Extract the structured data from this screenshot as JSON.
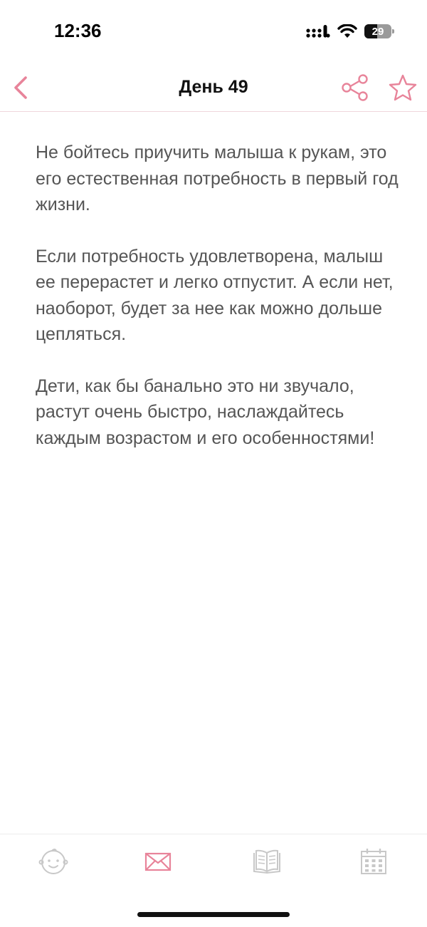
{
  "status_bar": {
    "time": "12:36",
    "battery_level": "29",
    "icons": [
      "cellular-signal-icon",
      "wifi-icon",
      "battery-icon"
    ]
  },
  "nav": {
    "title": "День 49",
    "icons": [
      "chevron-left-icon",
      "share-icon",
      "star-icon"
    ]
  },
  "content": {
    "paragraphs": [
      "Не бойтесь приучить малыша к рукам, это его естественная потребность в первый год жизни.",
      "Если потребность удовлетворена, малыш ее перерастет и легко отпустит. А если нет, наоборот, будет за нее как можно дольше цепляться.",
      "Дети, как бы банально это ни звучало, растут очень быстро, наслаждайтесь каждым возрастом и его особенностями!"
    ]
  },
  "tab_bar": {
    "active_tab": 1,
    "tabs": [
      {
        "icon": "baby-face-icon"
      },
      {
        "icon": "envelope-icon"
      },
      {
        "icon": "open-book-icon"
      },
      {
        "icon": "calendar-icon"
      }
    ]
  },
  "colors": {
    "accent": "#e8849a",
    "inactive_icon": "#c8c8c8",
    "body_text": "#555555",
    "title_text": "#111111",
    "divider": "#f0d6dc"
  }
}
